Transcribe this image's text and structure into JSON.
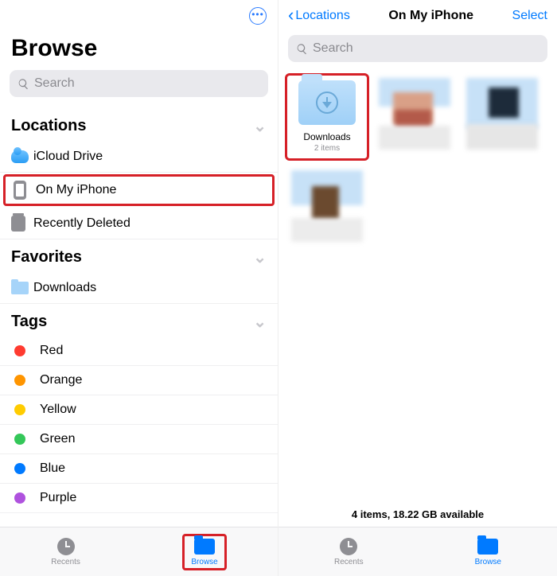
{
  "left": {
    "title": "Browse",
    "search_placeholder": "Search",
    "sections": {
      "locations": {
        "heading": "Locations",
        "items": [
          {
            "label": "iCloud Drive",
            "icon": "cloud"
          },
          {
            "label": "On My iPhone",
            "icon": "phone",
            "highlighted": true
          },
          {
            "label": "Recently Deleted",
            "icon": "trash"
          }
        ]
      },
      "favorites": {
        "heading": "Favorites",
        "items": [
          {
            "label": "Downloads",
            "icon": "folder"
          }
        ]
      },
      "tags": {
        "heading": "Tags",
        "items": [
          {
            "label": "Red",
            "color": "#ff3b30"
          },
          {
            "label": "Orange",
            "color": "#ff9500"
          },
          {
            "label": "Yellow",
            "color": "#ffcc00"
          },
          {
            "label": "Green",
            "color": "#34c759"
          },
          {
            "label": "Blue",
            "color": "#007aff"
          },
          {
            "label": "Purple",
            "color": "#af52de"
          }
        ]
      }
    },
    "tabs": {
      "recents": "Recents",
      "browse": "Browse",
      "active": "browse"
    }
  },
  "right": {
    "back_label": "Locations",
    "title": "On My iPhone",
    "select_label": "Select",
    "search_placeholder": "Search",
    "grid": [
      {
        "name": "Downloads",
        "meta": "2 items",
        "kind": "downloads-folder",
        "highlighted": true
      },
      {
        "name": "",
        "meta": "",
        "kind": "blurred"
      },
      {
        "name": "",
        "meta": "",
        "kind": "blurred"
      },
      {
        "name": "",
        "meta": "",
        "kind": "blurred"
      }
    ],
    "status": "4 items, 18.22 GB available",
    "tabs": {
      "recents": "Recents",
      "browse": "Browse",
      "active": "browse"
    }
  }
}
